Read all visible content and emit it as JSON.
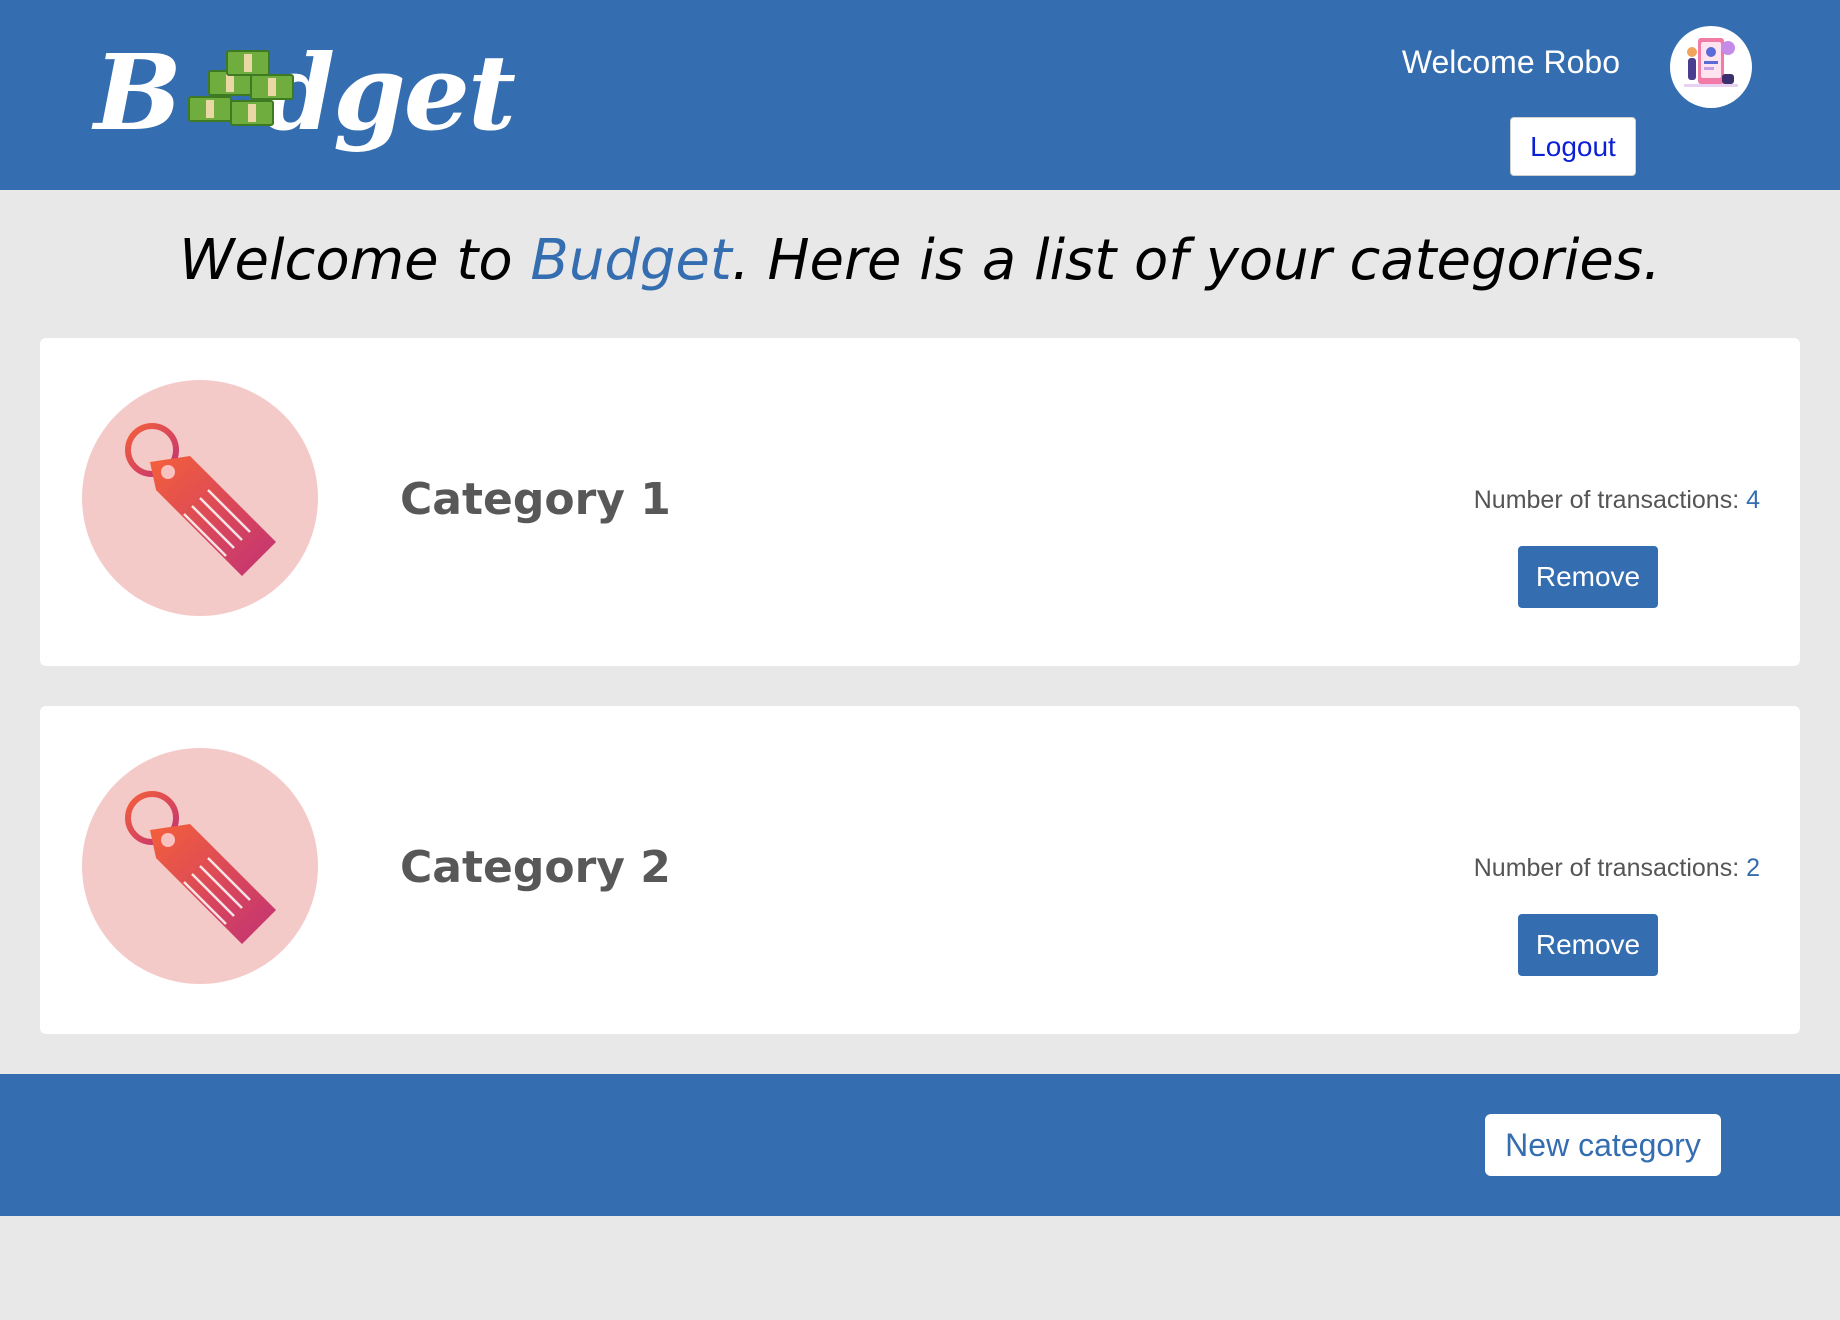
{
  "header": {
    "logo": {
      "prefix": "B",
      "suffix": "dget",
      "money_icon": "money-stack-icon"
    },
    "welcome_text": "Welcome Robo",
    "avatar_icon": "user-avatar-icon",
    "logout_label": "Logout"
  },
  "heading": {
    "before": "Welcome to ",
    "brand": "Budget",
    "after": ". Here is a list of your categories."
  },
  "categories": [
    {
      "name": "Category 1",
      "icon": "price-tag-icon",
      "transactions_label": "Number of transactions: ",
      "transactions_count": "4",
      "remove_label": "Remove"
    },
    {
      "name": "Category 2",
      "icon": "price-tag-icon",
      "transactions_label": "Number of transactions: ",
      "transactions_count": "2",
      "remove_label": "Remove"
    }
  ],
  "footer": {
    "new_category_label": "New category"
  },
  "colors": {
    "primary": "#346db0",
    "background": "#e8e8e8",
    "tag_circle": "#f4cac9",
    "logout_text": "#0b1fd6"
  }
}
